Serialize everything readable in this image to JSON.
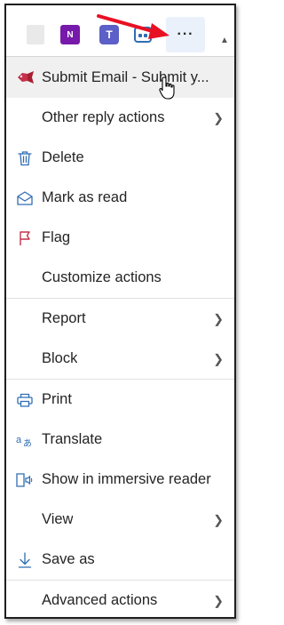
{
  "toolbar": {
    "more_label": "···",
    "onenote_letter": "N",
    "teams_letter": "T"
  },
  "menu": {
    "submit_email": "Submit Email - Submit y...",
    "other_reply": "Other reply actions",
    "delete": "Delete",
    "mark_as_read": "Mark as read",
    "flag": "Flag",
    "customize": "Customize actions",
    "report": "Report",
    "block": "Block",
    "print": "Print",
    "translate": "Translate",
    "immersive": "Show in immersive reader",
    "view": "View",
    "save_as": "Save as",
    "advanced": "Advanced actions"
  },
  "colors": {
    "accent": "#2f6db3",
    "flag": "#c4314b",
    "annotation_arrow": "#e81123"
  }
}
